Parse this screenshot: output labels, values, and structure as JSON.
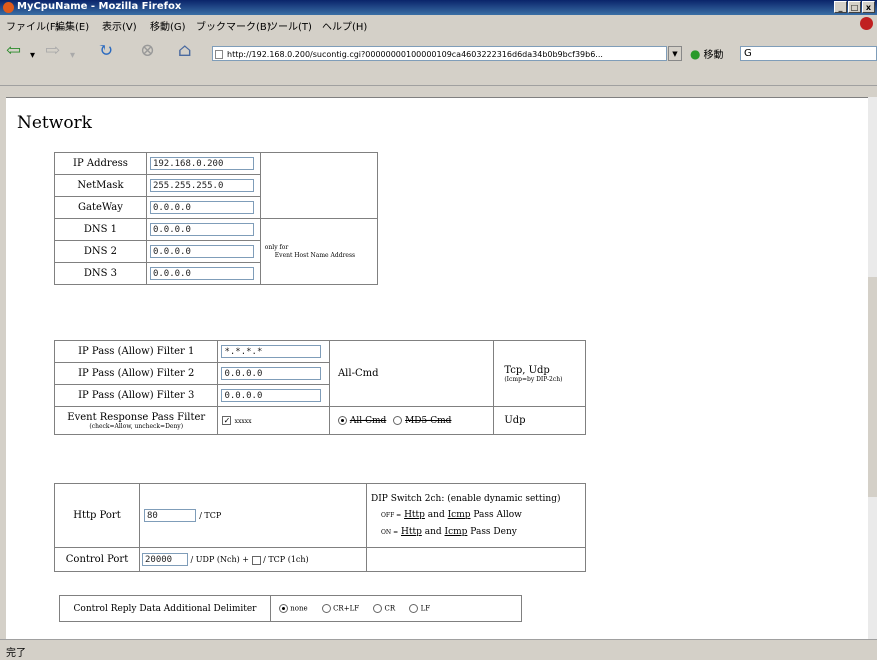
{
  "window": {
    "title": "MyCpuName - Mozilla Firefox"
  },
  "menu": [
    "ファイル(F)",
    "編集(E)",
    "表示(V)",
    "移動(G)",
    "ブックマーク(B)",
    "ツール(T)",
    "ヘルプ(H)"
  ],
  "nav": {
    "url": "http://192.168.0.200/sucontig.cgi?00000000100000109ca4603222316d6da34b0b9bcf39b6...",
    "go_label": "移動",
    "search_value": "G"
  },
  "status": "完了",
  "page": {
    "title": "Network",
    "net": {
      "ip_label": "IP Address",
      "ip_value": "192.168.0.200",
      "mask_label": "NetMask",
      "mask_value": "255.255.255.0",
      "gw_label": "GateWay",
      "gw_value": "0.0.0.0",
      "dns1_label": "DNS 1",
      "dns1_value": "0.0.0.0",
      "dns2_label": "DNS 2",
      "dns2_value": "0.0.0.0",
      "dns3_label": "DNS 3",
      "dns3_value": "0.0.0.0",
      "dns_note1": "only for",
      "dns_note2": "Event Host Name Address"
    },
    "filter": {
      "f1_label": "IP Pass (Allow) Filter 1",
      "f1_value": "*.*.*.*",
      "f2_label": "IP Pass (Allow) Filter 2",
      "f2_value": "0.0.0.0",
      "f3_label": "IP Pass (Allow) Filter 3",
      "f3_value": "0.0.0.0",
      "all_cmd": "All-Cmd",
      "tcp_udp": "Tcp, Udp",
      "tcp_udp_note": "(Icmp=by DIP-2ch)",
      "event_label": "Event Response Pass Filter",
      "event_note": "(check=Allow, uncheck=Deny)",
      "event_check": "xxxxx",
      "opt_all_cmd": "All-Cmd",
      "opt_md5_cmd": "MD5-Cmd",
      "udp": "Udp"
    },
    "ports": {
      "http_label": "Http Port",
      "http_value": "80",
      "http_suffix": "/ TCP",
      "dip_title": "DIP Switch 2ch: (enable dynamic setting)",
      "dip_off_prefix": "OFF =",
      "dip_off_http": "Http",
      "dip_off_and": "and",
      "dip_off_icmp": "Icmp",
      "dip_off_rest": "Pass Allow",
      "dip_on_prefix": "ON =",
      "dip_on_http": "Http",
      "dip_on_and": "and",
      "dip_on_icmp": "Icmp",
      "dip_on_rest": "Pass Deny",
      "control_label": "Control Port",
      "control_value": "20000",
      "control_udp": "/ UDP (Nch)",
      "control_plus": "+",
      "control_tcp": "/ TCP (1ch)"
    },
    "delim": {
      "label": "Control Reply Data Additional Delimiter",
      "options": [
        "none",
        "CR+LF",
        "CR",
        "LF"
      ],
      "selected": "none"
    }
  }
}
